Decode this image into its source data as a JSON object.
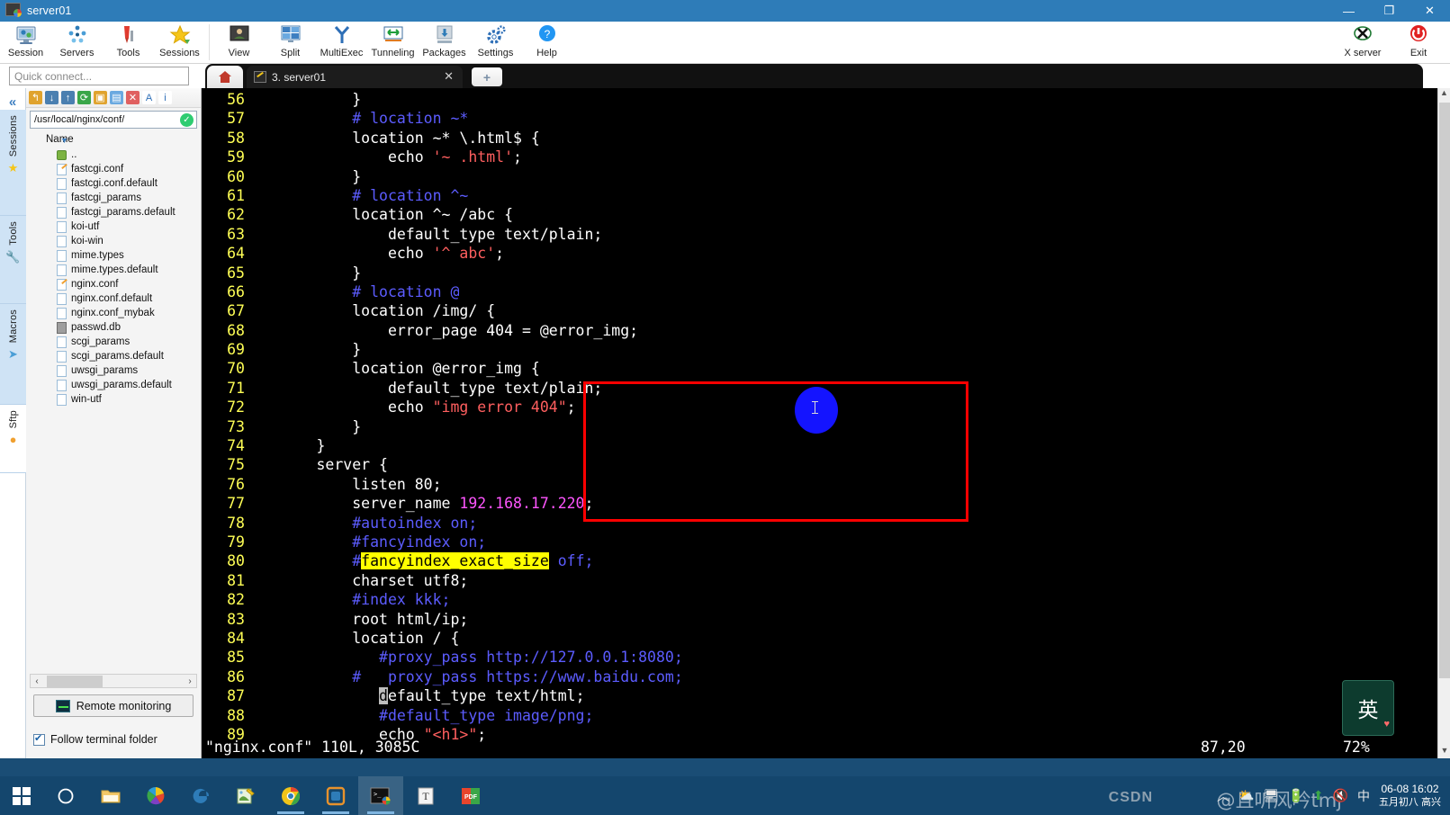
{
  "window": {
    "title": "server01",
    "minimize": "—",
    "maximize": "❐",
    "close": "✕"
  },
  "ribbon": {
    "items": [
      {
        "label": "Session",
        "icon": "session-icon"
      },
      {
        "label": "Servers",
        "icon": "servers-icon"
      },
      {
        "label": "Tools",
        "icon": "tools-icon"
      },
      {
        "label": "Sessions",
        "icon": "sessions-star-icon"
      },
      {
        "label": "View",
        "icon": "view-icon"
      },
      {
        "label": "Split",
        "icon": "split-icon"
      },
      {
        "label": "MultiExec",
        "icon": "multiexec-icon"
      },
      {
        "label": "Tunneling",
        "icon": "tunneling-icon"
      },
      {
        "label": "Packages",
        "icon": "packages-icon"
      },
      {
        "label": "Settings",
        "icon": "settings-gear-icon"
      },
      {
        "label": "Help",
        "icon": "help-icon"
      }
    ],
    "right": [
      {
        "label": "X server",
        "icon": "x-server-icon"
      },
      {
        "label": "Exit",
        "icon": "power-exit-icon"
      }
    ]
  },
  "quick_connect": {
    "placeholder": "Quick connect..."
  },
  "tabs": {
    "home_icon": "home-icon",
    "active": {
      "label": "3. server01",
      "close": "✕"
    },
    "new_tab": "+"
  },
  "rail": {
    "collapse": "«",
    "items": [
      {
        "label": "Sessions",
        "glyph": "★"
      },
      {
        "label": "Tools",
        "glyph": "🔧"
      },
      {
        "label": "Macros",
        "glyph": "➤"
      },
      {
        "label": "Sftp",
        "glyph": "●"
      }
    ]
  },
  "sftp": {
    "path": "/usr/local/nginx/conf/",
    "path_ok": "✓",
    "column_header": "Name",
    "toolbar_icons": [
      "upload-parent-icon",
      "download-icon",
      "upload-icon",
      "refresh-icon",
      "new-folder-icon",
      "new-file-icon",
      "delete-icon",
      "text-mode-icon",
      "info-icon"
    ],
    "files": [
      {
        "name": "..",
        "type": "folder"
      },
      {
        "name": "fastcgi.conf",
        "type": "edit"
      },
      {
        "name": "fastcgi.conf.default",
        "type": "file"
      },
      {
        "name": "fastcgi_params",
        "type": "file"
      },
      {
        "name": "fastcgi_params.default",
        "type": "file"
      },
      {
        "name": "koi-utf",
        "type": "file"
      },
      {
        "name": "koi-win",
        "type": "file"
      },
      {
        "name": "mime.types",
        "type": "file"
      },
      {
        "name": "mime.types.default",
        "type": "file"
      },
      {
        "name": "nginx.conf",
        "type": "edit"
      },
      {
        "name": "nginx.conf.default",
        "type": "file"
      },
      {
        "name": "nginx.conf_mybak",
        "type": "file"
      },
      {
        "name": "passwd.db",
        "type": "db"
      },
      {
        "name": "scgi_params",
        "type": "file"
      },
      {
        "name": "scgi_params.default",
        "type": "file"
      },
      {
        "name": "uwsgi_params",
        "type": "file"
      },
      {
        "name": "uwsgi_params.default",
        "type": "file"
      },
      {
        "name": "win-utf",
        "type": "file"
      }
    ],
    "remote_monitoring": "Remote monitoring",
    "follow_terminal_folder": "Follow terminal folder",
    "scroll_left": "‹",
    "scroll_right": "›"
  },
  "terminal": {
    "lines": [
      {
        "no": "56",
        "segs": [
          {
            "t": "            }",
            "c": "code"
          }
        ]
      },
      {
        "no": "57",
        "segs": [
          {
            "t": "            # location ~*",
            "c": "c-comment"
          }
        ]
      },
      {
        "no": "58",
        "segs": [
          {
            "t": "            location ~* \\.html$ {",
            "c": "code"
          }
        ]
      },
      {
        "no": "59",
        "segs": [
          {
            "t": "                echo ",
            "c": "code"
          },
          {
            "t": "'~ .html'",
            "c": "c-str"
          },
          {
            "t": ";",
            "c": "code"
          }
        ]
      },
      {
        "no": "60",
        "segs": [
          {
            "t": "            }",
            "c": "code"
          }
        ]
      },
      {
        "no": "61",
        "segs": [
          {
            "t": "            # location ^~",
            "c": "c-comment"
          }
        ]
      },
      {
        "no": "62",
        "segs": [
          {
            "t": "            location ^~ /abc {",
            "c": "code"
          }
        ]
      },
      {
        "no": "63",
        "segs": [
          {
            "t": "                default_type text/plain;",
            "c": "code"
          }
        ]
      },
      {
        "no": "64",
        "segs": [
          {
            "t": "                echo ",
            "c": "code"
          },
          {
            "t": "'^ abc'",
            "c": "c-str"
          },
          {
            "t": ";",
            "c": "code"
          }
        ]
      },
      {
        "no": "65",
        "segs": [
          {
            "t": "            }",
            "c": "code"
          }
        ]
      },
      {
        "no": "66",
        "segs": [
          {
            "t": "            # location @",
            "c": "c-comment"
          }
        ]
      },
      {
        "no": "67",
        "segs": [
          {
            "t": "            location /img/ {",
            "c": "code"
          }
        ]
      },
      {
        "no": "68",
        "segs": [
          {
            "t": "                error_page 404 = @error_img;",
            "c": "code"
          }
        ]
      },
      {
        "no": "69",
        "segs": [
          {
            "t": "            }",
            "c": "code"
          }
        ]
      },
      {
        "no": "70",
        "segs": [
          {
            "t": "            location @error_img {",
            "c": "code"
          }
        ]
      },
      {
        "no": "71",
        "segs": [
          {
            "t": "                default_type text/plain;",
            "c": "code"
          }
        ]
      },
      {
        "no": "72",
        "segs": [
          {
            "t": "                echo ",
            "c": "code"
          },
          {
            "t": "\"img error 404\"",
            "c": "c-str"
          },
          {
            "t": ";",
            "c": "code"
          }
        ]
      },
      {
        "no": "73",
        "segs": [
          {
            "t": "            }",
            "c": "code"
          }
        ]
      },
      {
        "no": "74",
        "segs": [
          {
            "t": "        }",
            "c": "code"
          }
        ]
      },
      {
        "no": "75",
        "segs": [
          {
            "t": "        server {",
            "c": "code"
          }
        ]
      },
      {
        "no": "76",
        "segs": [
          {
            "t": "            listen 80;",
            "c": "code"
          }
        ]
      },
      {
        "no": "77",
        "segs": [
          {
            "t": "            server_name ",
            "c": "code"
          },
          {
            "t": "192.168.17.220",
            "c": "c-num"
          },
          {
            "t": ";",
            "c": "code"
          }
        ]
      },
      {
        "no": "78",
        "segs": [
          {
            "t": "            #autoindex on;",
            "c": "c-comment"
          }
        ]
      },
      {
        "no": "79",
        "segs": [
          {
            "t": "            #fancyindex on;",
            "c": "c-comment"
          }
        ]
      },
      {
        "no": "80",
        "segs": [
          {
            "t": "            #",
            "c": "c-comment"
          },
          {
            "t": "fancyindex_exact_size",
            "c": "hl"
          },
          {
            "t": " off;",
            "c": "c-comment"
          }
        ]
      },
      {
        "no": "81",
        "segs": [
          {
            "t": "            charset utf8;",
            "c": "code"
          }
        ]
      },
      {
        "no": "82",
        "segs": [
          {
            "t": "            #index kkk;",
            "c": "c-comment"
          }
        ]
      },
      {
        "no": "83",
        "segs": [
          {
            "t": "            root html/ip;",
            "c": "code"
          }
        ]
      },
      {
        "no": "84",
        "segs": [
          {
            "t": "            location / {",
            "c": "code"
          }
        ]
      },
      {
        "no": "85",
        "segs": [
          {
            "t": "               #proxy_pass http://127.0.0.1:8080;",
            "c": "c-comment"
          }
        ]
      },
      {
        "no": "86",
        "segs": [
          {
            "t": "            #   proxy_pass https://www.baidu.com;",
            "c": "c-comment"
          }
        ]
      },
      {
        "no": "87",
        "segs": [
          {
            "t": "               ",
            "c": "code"
          },
          {
            "t": "d",
            "c": "cursorblock"
          },
          {
            "t": "efault_type text/html;",
            "c": "code"
          }
        ]
      },
      {
        "no": "88",
        "segs": [
          {
            "t": "               #default_type image/png;",
            "c": "c-comment"
          }
        ]
      },
      {
        "no": "89",
        "segs": [
          {
            "t": "               echo ",
            "c": "code"
          },
          {
            "t": "\"<h1>\"",
            "c": "c-str"
          },
          {
            "t": ";",
            "c": "code"
          }
        ]
      }
    ],
    "status": {
      "file_info": "\"nginx.conf\" 110L, 3085C",
      "position": "87,20",
      "percent": "72%"
    },
    "annotations": {
      "red_box": "highlight-box",
      "blue_dot": "cursor-marker"
    }
  },
  "ime": {
    "mode": "英"
  },
  "taskbar": {
    "start": "start-button",
    "apps": [
      {
        "name": "cortana-search-icon",
        "glyph": "◯"
      },
      {
        "name": "file-explorer-icon",
        "glyph": "🗀"
      },
      {
        "name": "photos-icon",
        "glyph": "✹"
      },
      {
        "name": "edge-icon",
        "glyph": "e"
      },
      {
        "name": "notepad-app-icon",
        "glyph": "✎"
      },
      {
        "name": "chrome-icon",
        "glyph": "◉"
      },
      {
        "name": "vmware-icon",
        "glyph": "▣"
      },
      {
        "name": "mobaxterm-icon",
        "glyph": "▰"
      },
      {
        "name": "typora-icon",
        "glyph": "T"
      },
      {
        "name": "pdf-reader-icon",
        "glyph": "PDF"
      }
    ],
    "tray": {
      "expand": "︿",
      "icons": [
        "weather-icon",
        "network-icon",
        "battery-icon",
        "update-icon",
        "volume-muted-icon",
        "ime-icon"
      ],
      "clock_time": "06-08 16:02",
      "clock_date": "五月初八 高兴"
    },
    "watermark": "@且听风吟tmj",
    "watermark_brand": "CSDN"
  },
  "colors": {
    "titlebar": "#2e7cb8",
    "terminal_bg": "#000000",
    "line_number": "#ffff55",
    "comment": "#5c5cff",
    "string": "#ff5f5f",
    "number": "#ff55ff",
    "highlight": "#ffff00",
    "redbox": "#ff0000",
    "bluedot": "#1414ff",
    "taskbar": "#14466d"
  }
}
